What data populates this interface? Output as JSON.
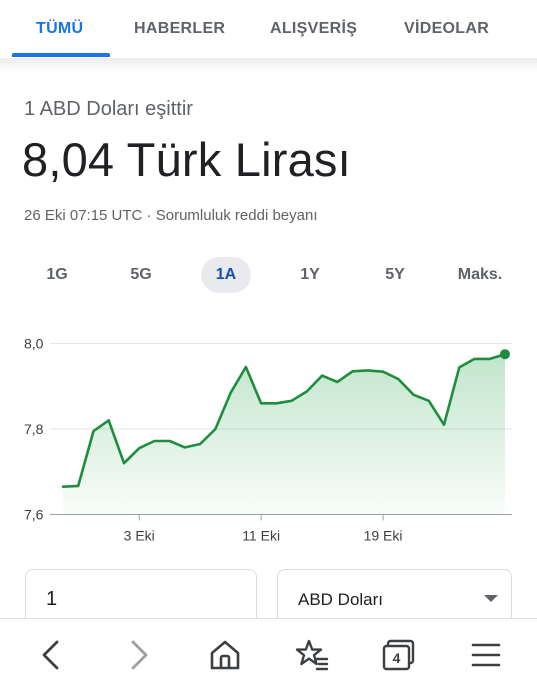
{
  "tabs": [
    {
      "label": "TÜMÜ",
      "active": true
    },
    {
      "label": "HABERLER",
      "active": false
    },
    {
      "label": "ALIŞVERİŞ",
      "active": false
    },
    {
      "label": "VİDEOLAR",
      "active": false
    }
  ],
  "converter": {
    "equals_text": "1 ABD Doları eşittir",
    "result": "8,04 Türk Lirası",
    "timestamp": "26 Eki 07:15 UTC",
    "separator": " · ",
    "disclaimer": "Sorumluluk reddi beyanı"
  },
  "ranges": [
    {
      "label": "1G",
      "active": false
    },
    {
      "label": "5G",
      "active": false
    },
    {
      "label": "1A",
      "active": true
    },
    {
      "label": "1Y",
      "active": false
    },
    {
      "label": "5Y",
      "active": false
    },
    {
      "label": "Maks.",
      "active": false
    }
  ],
  "chart_data": {
    "type": "area",
    "title": "",
    "xlabel": "",
    "ylabel": "",
    "ylim": [
      7.6,
      8.0
    ],
    "y_ticks": [
      {
        "value": 8.0,
        "label": "8,0"
      },
      {
        "value": 7.8,
        "label": "7,8"
      },
      {
        "value": 7.6,
        "label": "7,6"
      }
    ],
    "x_ticks": [
      {
        "index": 5,
        "label": "3 Eki"
      },
      {
        "index": 13,
        "label": "11 Eki"
      },
      {
        "index": 21,
        "label": "19 Eki"
      }
    ],
    "values": [
      7.665,
      7.667,
      7.795,
      7.82,
      7.72,
      7.755,
      7.772,
      7.772,
      7.757,
      7.765,
      7.8,
      7.885,
      7.945,
      7.86,
      7.86,
      7.866,
      7.888,
      7.925,
      7.91,
      7.935,
      7.937,
      7.934,
      7.917,
      7.88,
      7.866,
      7.81,
      7.944,
      7.964,
      7.964,
      7.975
    ],
    "grid": true,
    "line_color": "#1e8e3e",
    "fill_color": "#34a853"
  },
  "inputs": {
    "amount_value": "1",
    "currency_value": "ABD Doları"
  },
  "bottom_nav": [
    {
      "icon": "back-arrow-icon",
      "enabled": true
    },
    {
      "icon": "forward-arrow-icon",
      "enabled": false
    },
    {
      "icon": "home-icon",
      "enabled": true
    },
    {
      "icon": "star-list-icon",
      "enabled": true
    },
    {
      "icon": "tabs-icon",
      "enabled": true,
      "count": "4"
    },
    {
      "icon": "menu-icon",
      "enabled": true
    }
  ]
}
